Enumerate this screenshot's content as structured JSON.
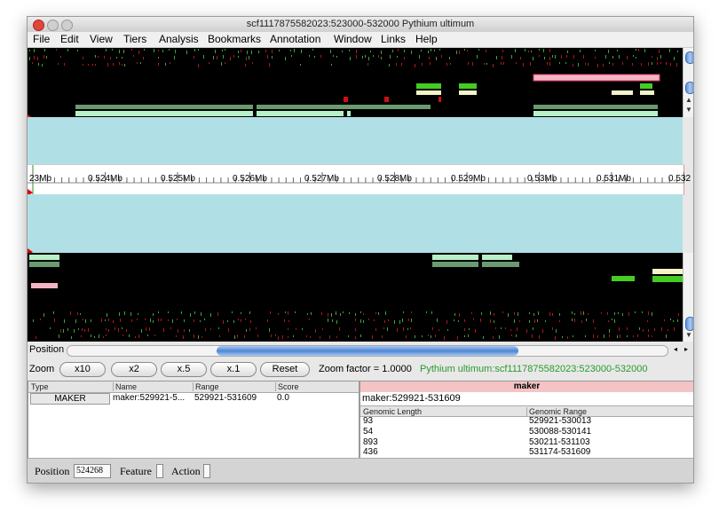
{
  "window": {
    "title": "scf1117875582023:523000-532000 Pythium ultimum"
  },
  "menu": [
    "File",
    "Edit",
    "View",
    "Tiers",
    "Analysis",
    "Bookmarks",
    "Annotation",
    "Window",
    "Links",
    "Help"
  ],
  "axis": {
    "labels": [
      "23Mb",
      "0.524Mb",
      "0.525Mb",
      "0.526Mb",
      "0.527Mb",
      "0.528Mb",
      "0.529Mb",
      "0.53Mb",
      "0.531Mb",
      "0.532"
    ]
  },
  "navigation": {
    "position_label": "Position",
    "zoom_label": "Zoom",
    "zoom_buttons": [
      "x10",
      "x2",
      "x.5",
      "x.1"
    ],
    "reset_label": "Reset",
    "zoom_factor": "Zoom factor = 1.0000",
    "location": "Pythium ultimum:scf1117875582023:523000-532000"
  },
  "result_table": {
    "columns": [
      "Type",
      "Name",
      "Range",
      "Score"
    ],
    "rows": [
      {
        "type": "MAKER",
        "name": "maker:529921-5...",
        "range": "529921-531609",
        "score": "0.0"
      }
    ]
  },
  "detail_panel": {
    "title": "maker",
    "feature_name": "maker:529921-531609",
    "columns": [
      "Genomic Length",
      "Genomic Range"
    ],
    "rows": [
      {
        "length": "93",
        "range": "529921-530013"
      },
      {
        "length": "54",
        "range": "530088-530141"
      },
      {
        "length": "893",
        "range": "530211-531103"
      },
      {
        "length": "436",
        "range": "531174-531609"
      }
    ]
  },
  "status_bar": {
    "position_label": "Position",
    "position_value": "524268",
    "feature_label": "Feature",
    "action_label": "Action"
  },
  "colors": {
    "track_background": "#000000",
    "strand_band": "#b0e0e6",
    "gene_model_green": "#6b9a70",
    "light_green": "#b8f0c8",
    "pink_feature": "#f4b4c4",
    "bright_green": "#44cc22",
    "location_text": "#2a9a2a",
    "detail_header": "#f4c4c4"
  }
}
